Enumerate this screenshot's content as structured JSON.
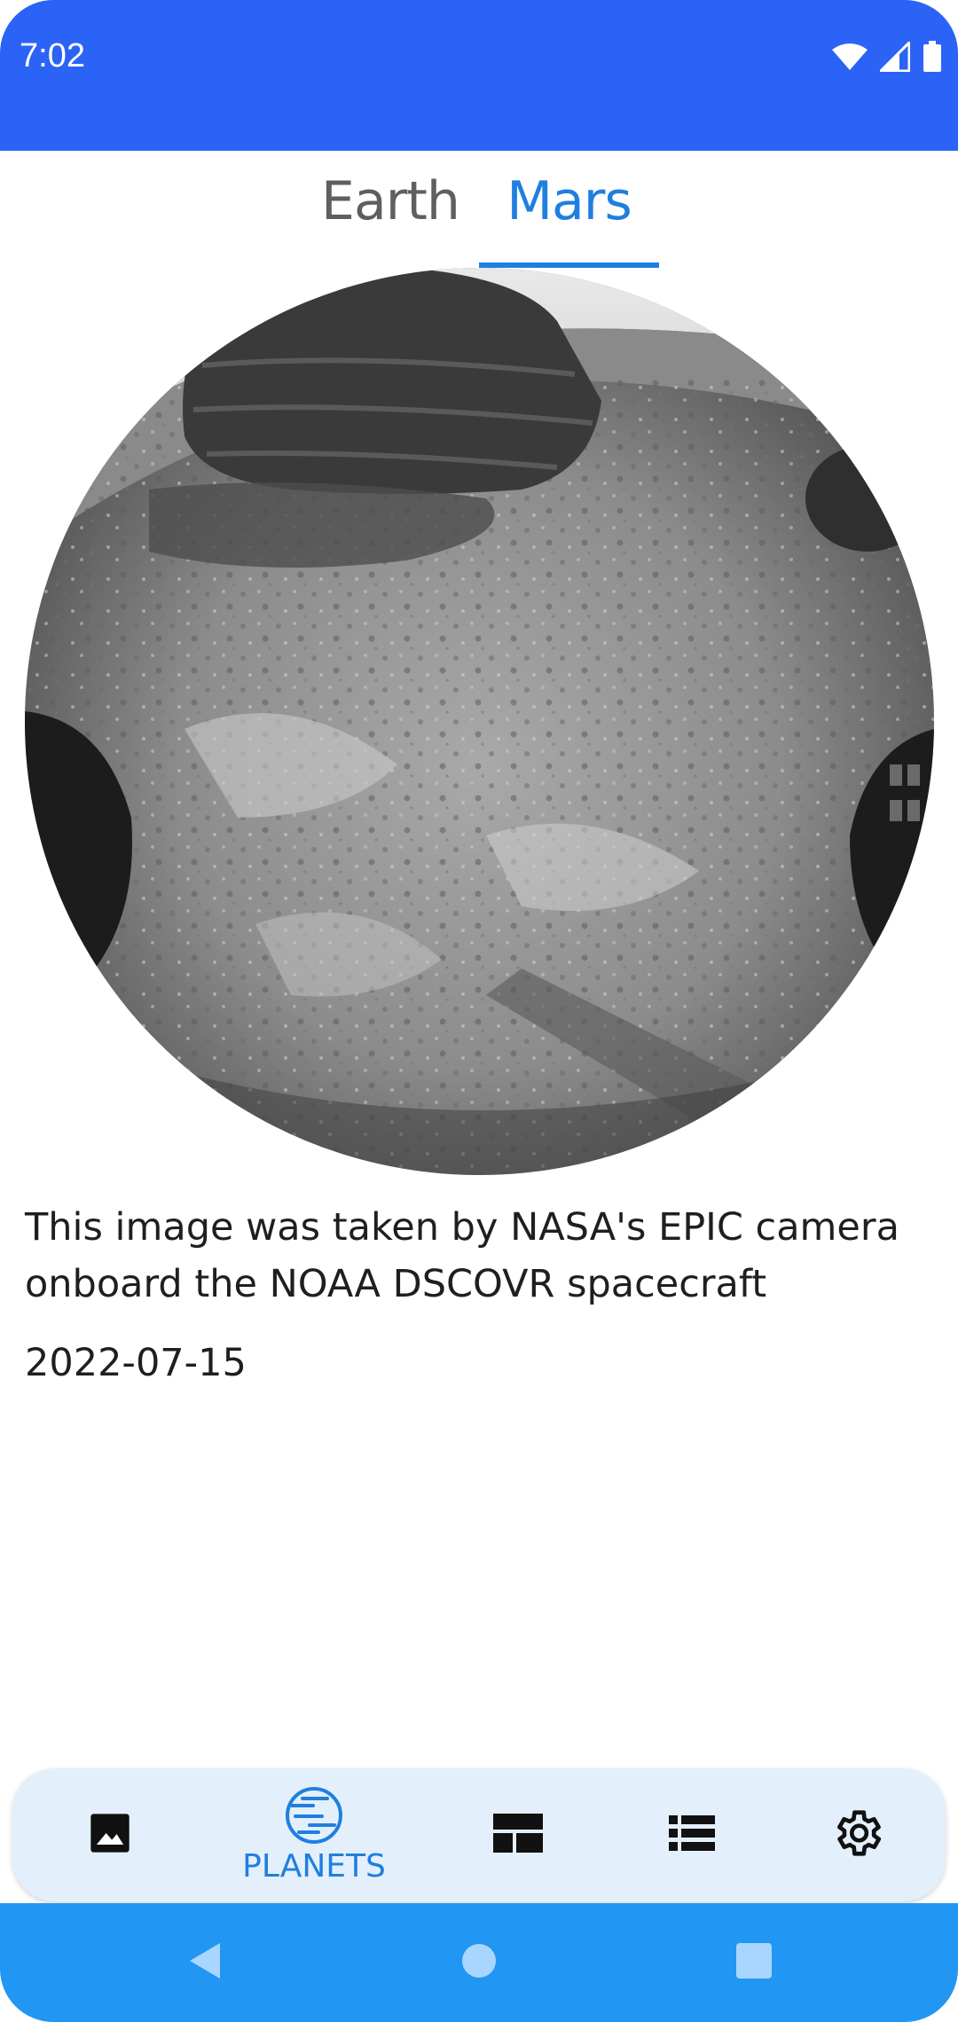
{
  "status_bar": {
    "time": "7:02",
    "icons": [
      "wifi-icon",
      "signal-icon",
      "battery-icon"
    ],
    "color": "#2c63f7"
  },
  "tabs": [
    {
      "label": "Earth",
      "selected": false
    },
    {
      "label": "Mars",
      "selected": true
    }
  ],
  "content": {
    "image_alt": "Mars rover fisheye camera photo",
    "description": "This image was taken by NASA's EPIC camera onboard the NOAA DSCOVR spacecraft",
    "date": "2022-07-15"
  },
  "bottom_nav": {
    "items": [
      {
        "icon": "image-icon",
        "label": "",
        "selected": false
      },
      {
        "icon": "planet-icon",
        "label": "PLANETS",
        "selected": true
      },
      {
        "icon": "layout-icon",
        "label": "",
        "selected": false
      },
      {
        "icon": "list-icon",
        "label": "",
        "selected": false
      },
      {
        "icon": "gear-icon",
        "label": "",
        "selected": false
      }
    ]
  },
  "colors": {
    "accent": "#1f7fe0",
    "status_bar": "#2c63f7",
    "system_nav": "#2196f3",
    "nav_background": "#e3f0fb"
  }
}
